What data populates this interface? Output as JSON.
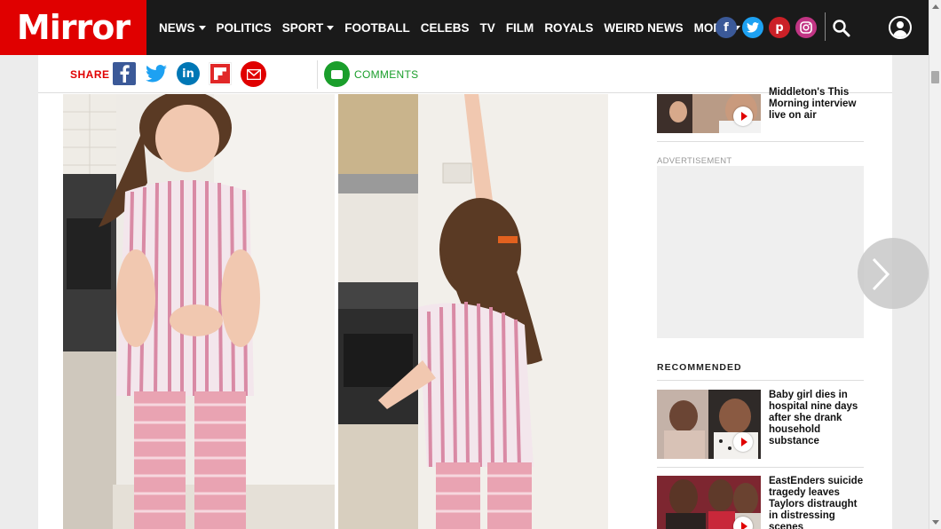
{
  "brand": {
    "logo_text": "Mirror",
    "color": "#e00000"
  },
  "nav": {
    "items": [
      {
        "label": "NEWS",
        "dropdown": true
      },
      {
        "label": "POLITICS",
        "dropdown": false
      },
      {
        "label": "SPORT",
        "dropdown": true
      },
      {
        "label": "FOOTBALL",
        "dropdown": false
      },
      {
        "label": "CELEBS",
        "dropdown": false
      },
      {
        "label": "TV",
        "dropdown": false
      },
      {
        "label": "FILM",
        "dropdown": false
      },
      {
        "label": "ROYALS",
        "dropdown": false
      },
      {
        "label": "WEIRD NEWS",
        "dropdown": false
      },
      {
        "label": "MORE",
        "dropdown": true
      }
    ],
    "social": [
      {
        "icon": "facebook-icon",
        "glyph": "f",
        "color": "#3b5998"
      },
      {
        "icon": "twitter-icon",
        "glyph": "t",
        "color": "#1da1f2"
      },
      {
        "icon": "pinterest-icon",
        "glyph": "p",
        "color": "#cb2027"
      },
      {
        "icon": "instagram-icon",
        "glyph": "◎",
        "color": "#c13584"
      }
    ]
  },
  "share": {
    "label": "SHARE",
    "icons": [
      {
        "icon": "facebook-icon",
        "glyph": "f",
        "color": "#3b5998"
      },
      {
        "icon": "twitter-icon",
        "glyph": "t",
        "color": "#1da1f2"
      },
      {
        "icon": "linkedin-icon",
        "glyph": "in",
        "color": "#0077b5"
      },
      {
        "icon": "flipboard-icon",
        "glyph": "f",
        "color": "#e12828"
      },
      {
        "icon": "email-icon",
        "glyph": "✉",
        "color": "#e00000"
      }
    ],
    "comments_label": "COMMENTS"
  },
  "sidebar": {
    "top_story": {
      "title": "Middleton's This Morning interview live on air"
    },
    "ad_label": "ADVERTISEMENT",
    "recommended_label": "RECOMMENDED",
    "stories": [
      {
        "title": "Baby girl dies in hospital nine days after she drank household substance"
      },
      {
        "title": "EastEnders suicide tragedy leaves Taylors distraught in distressing scenes"
      }
    ]
  }
}
